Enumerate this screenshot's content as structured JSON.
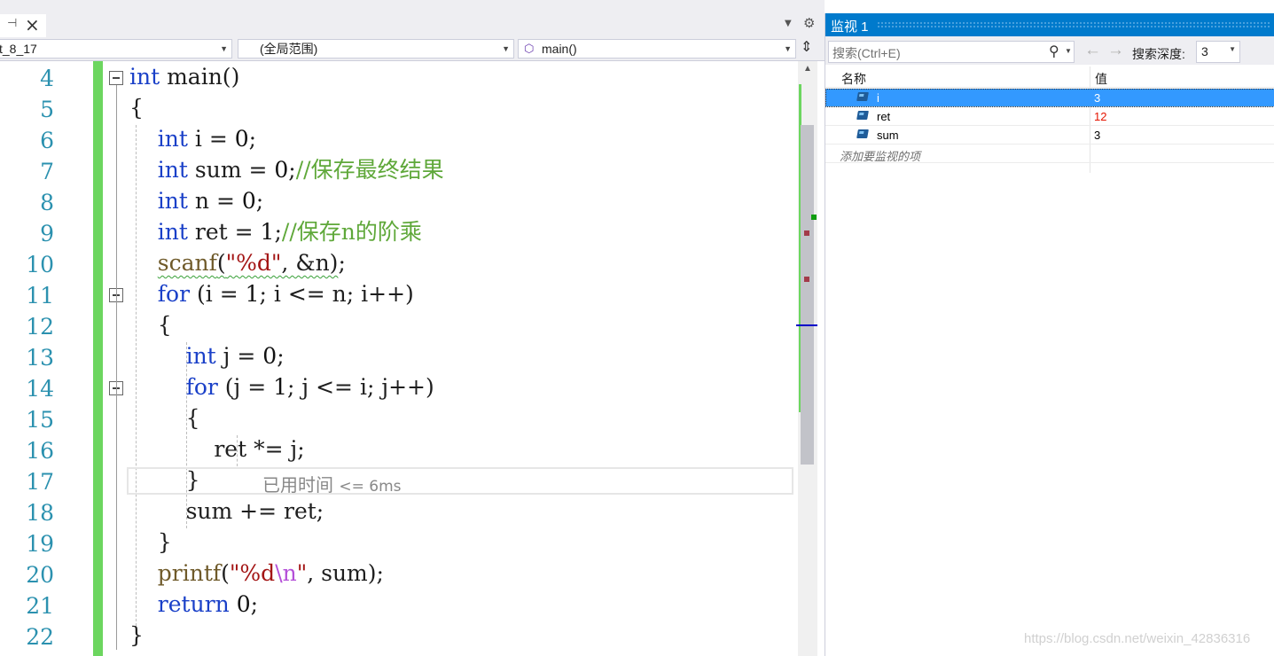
{
  "editor_tab": {
    "pin_icon": "pin-icon",
    "close_icon": "close-icon"
  },
  "navbar": {
    "project": "t_8_17",
    "scope": "(全局范围)",
    "member": "main()"
  },
  "code": {
    "line_numbers": [
      "4",
      "5",
      "6",
      "7",
      "8",
      "9",
      "10",
      "11",
      "12",
      "13",
      "14",
      "15",
      "16",
      "17",
      "18",
      "19",
      "20",
      "21",
      "22"
    ],
    "elapsed_text": "已用时间",
    "elapsed_value": "<= 6ms"
  },
  "watch": {
    "title": "监视 1",
    "search_placeholder": "搜索(Ctrl+E)",
    "depth_label": "搜索深度:",
    "depth_value": "3",
    "col_name": "名称",
    "col_value": "值",
    "rows": [
      {
        "name": "i",
        "value": "3",
        "selected": true,
        "changed": false
      },
      {
        "name": "ret",
        "value": "12",
        "selected": false,
        "changed": true
      },
      {
        "name": "sum",
        "value": "3",
        "selected": false,
        "changed": false
      }
    ],
    "add_placeholder": "添加要监视的项"
  },
  "watermark": "https://blog.csdn.net/weixin_42836316",
  "colors": {
    "accent": "#007acc",
    "selection": "#3399ff",
    "change_bar": "#6cd65f",
    "keyword": "#1a40c8",
    "comment": "#5fa83a",
    "changed_value": "#e51400"
  }
}
